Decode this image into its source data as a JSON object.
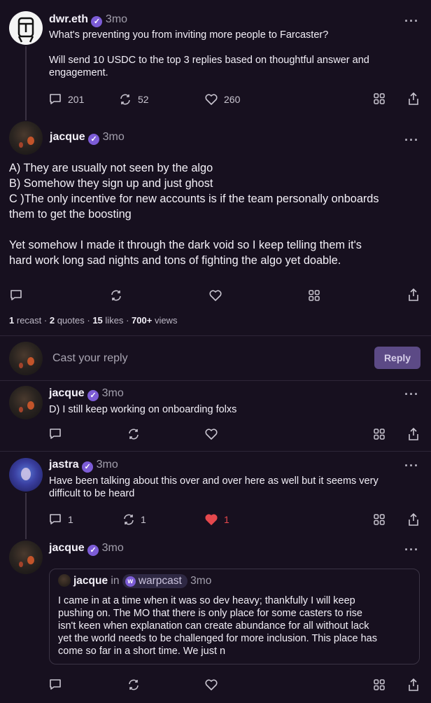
{
  "post1": {
    "username": "dwr.eth",
    "time": "3mo",
    "more": "···",
    "text_line1": "What's preventing you from inviting more people to Farcaster?",
    "text_line2": "Will send 10 USDC to the top 3 replies based on thoughtful answer and",
    "text_line3": "engagement.",
    "replies": "201",
    "recasts": "52",
    "likes": "260"
  },
  "main": {
    "username": "jacque",
    "time": "3mo",
    "more": "···",
    "lines": [
      "A) They are usually not seen by the algo",
      "B) Somehow they sign up and just ghost",
      "C )The only incentive for new accounts is if the team personally onboards",
      "them to get the boosting",
      "Yet somehow I made it through the dark void so I keep telling them it's",
      "hard work long sad nights and tons of fighting the algo yet doable."
    ],
    "stats": {
      "recast_num": "1",
      "recast_label": "recast",
      "quotes_num": "2",
      "quotes_label": "quotes",
      "likes_num": "15",
      "likes_label": "likes",
      "views_num": "700+",
      "views_label": "views"
    }
  },
  "composer": {
    "placeholder": "Cast your reply",
    "button": "Reply"
  },
  "reply1": {
    "username": "jacque",
    "time": "3mo",
    "more": "···",
    "text": "D) I still keep working on onboarding folxs"
  },
  "reply2": {
    "username": "jastra",
    "time": "3mo",
    "more": "···",
    "text_line1": "Have been talking about this over and over here as well but it seems very",
    "text_line2": "difficult to be heard",
    "replies": "1",
    "recasts": "1",
    "likes": "1"
  },
  "reply3": {
    "username": "jacque",
    "time": "3mo",
    "more": "···",
    "quote": {
      "username": "jacque",
      "in": "in",
      "channel_icon": "w",
      "channel": "warpcast",
      "time": "3mo",
      "lines": [
        "I came in at a time when it was so dev heavy; thankfully I will keep",
        "pushing on. The MO that there is only place for some casters to rise",
        "isn't keen when explanation can create abundance for all without lack",
        "yet the world needs to be challenged for more inclusion. This place has",
        "come so far in a short time. We just n"
      ]
    }
  },
  "colors": {
    "background": "#17101f",
    "accent": "#7c5cd6",
    "liked": "#e5484d"
  }
}
